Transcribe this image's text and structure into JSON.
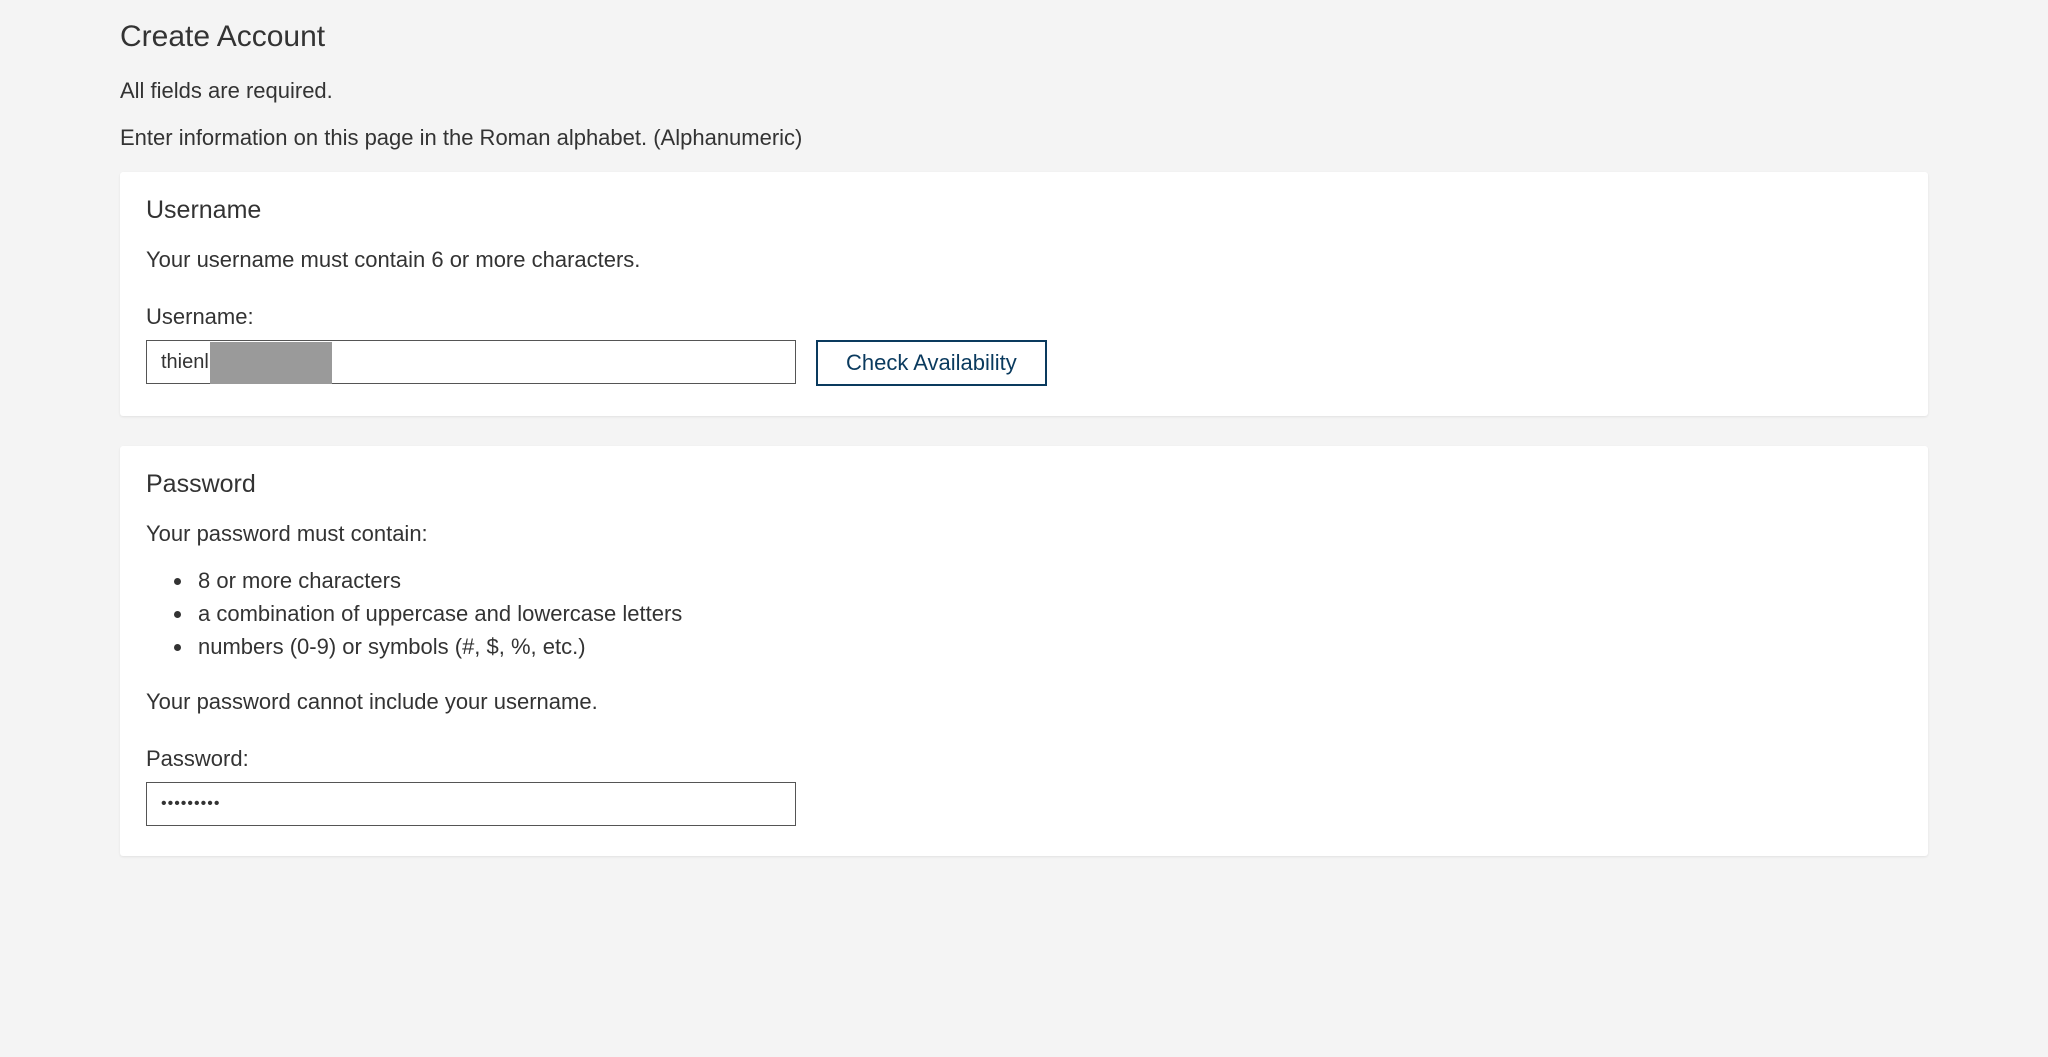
{
  "page": {
    "title": "Create Account",
    "intro1": "All fields are required.",
    "intro2": "Enter information on this page in the Roman alphabet. (Alphanumeric)"
  },
  "username": {
    "section_title": "Username",
    "helper": "Your username must contain 6 or more characters.",
    "label": "Username:",
    "value": "thienl",
    "check_button": "Check Availability"
  },
  "password": {
    "section_title": "Password",
    "req_intro": "Your password must contain:",
    "requirements": [
      "8 or more characters",
      "a combination of uppercase and lowercase letters",
      "numbers (0-9) or symbols (#, $, %, etc.)"
    ],
    "req_outro": "Your password cannot include your username.",
    "label": "Password:",
    "masked_value": "•••••••••"
  }
}
